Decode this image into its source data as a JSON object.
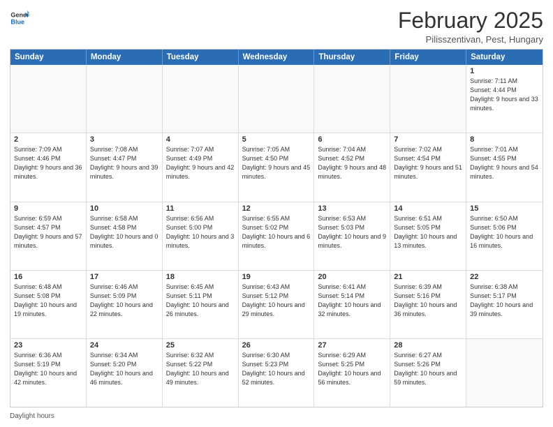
{
  "logo": {
    "general": "General",
    "blue": "Blue"
  },
  "title": "February 2025",
  "location": "Pilisszentivan, Pest, Hungary",
  "header_days": [
    "Sunday",
    "Monday",
    "Tuesday",
    "Wednesday",
    "Thursday",
    "Friday",
    "Saturday"
  ],
  "weeks": [
    [
      {
        "day": "",
        "info": ""
      },
      {
        "day": "",
        "info": ""
      },
      {
        "day": "",
        "info": ""
      },
      {
        "day": "",
        "info": ""
      },
      {
        "day": "",
        "info": ""
      },
      {
        "day": "",
        "info": ""
      },
      {
        "day": "1",
        "info": "Sunrise: 7:11 AM\nSunset: 4:44 PM\nDaylight: 9 hours and 33 minutes."
      }
    ],
    [
      {
        "day": "2",
        "info": "Sunrise: 7:09 AM\nSunset: 4:46 PM\nDaylight: 9 hours and 36 minutes."
      },
      {
        "day": "3",
        "info": "Sunrise: 7:08 AM\nSunset: 4:47 PM\nDaylight: 9 hours and 39 minutes."
      },
      {
        "day": "4",
        "info": "Sunrise: 7:07 AM\nSunset: 4:49 PM\nDaylight: 9 hours and 42 minutes."
      },
      {
        "day": "5",
        "info": "Sunrise: 7:05 AM\nSunset: 4:50 PM\nDaylight: 9 hours and 45 minutes."
      },
      {
        "day": "6",
        "info": "Sunrise: 7:04 AM\nSunset: 4:52 PM\nDaylight: 9 hours and 48 minutes."
      },
      {
        "day": "7",
        "info": "Sunrise: 7:02 AM\nSunset: 4:54 PM\nDaylight: 9 hours and 51 minutes."
      },
      {
        "day": "8",
        "info": "Sunrise: 7:01 AM\nSunset: 4:55 PM\nDaylight: 9 hours and 54 minutes."
      }
    ],
    [
      {
        "day": "9",
        "info": "Sunrise: 6:59 AM\nSunset: 4:57 PM\nDaylight: 9 hours and 57 minutes."
      },
      {
        "day": "10",
        "info": "Sunrise: 6:58 AM\nSunset: 4:58 PM\nDaylight: 10 hours and 0 minutes."
      },
      {
        "day": "11",
        "info": "Sunrise: 6:56 AM\nSunset: 5:00 PM\nDaylight: 10 hours and 3 minutes."
      },
      {
        "day": "12",
        "info": "Sunrise: 6:55 AM\nSunset: 5:02 PM\nDaylight: 10 hours and 6 minutes."
      },
      {
        "day": "13",
        "info": "Sunrise: 6:53 AM\nSunset: 5:03 PM\nDaylight: 10 hours and 9 minutes."
      },
      {
        "day": "14",
        "info": "Sunrise: 6:51 AM\nSunset: 5:05 PM\nDaylight: 10 hours and 13 minutes."
      },
      {
        "day": "15",
        "info": "Sunrise: 6:50 AM\nSunset: 5:06 PM\nDaylight: 10 hours and 16 minutes."
      }
    ],
    [
      {
        "day": "16",
        "info": "Sunrise: 6:48 AM\nSunset: 5:08 PM\nDaylight: 10 hours and 19 minutes."
      },
      {
        "day": "17",
        "info": "Sunrise: 6:46 AM\nSunset: 5:09 PM\nDaylight: 10 hours and 22 minutes."
      },
      {
        "day": "18",
        "info": "Sunrise: 6:45 AM\nSunset: 5:11 PM\nDaylight: 10 hours and 26 minutes."
      },
      {
        "day": "19",
        "info": "Sunrise: 6:43 AM\nSunset: 5:12 PM\nDaylight: 10 hours and 29 minutes."
      },
      {
        "day": "20",
        "info": "Sunrise: 6:41 AM\nSunset: 5:14 PM\nDaylight: 10 hours and 32 minutes."
      },
      {
        "day": "21",
        "info": "Sunrise: 6:39 AM\nSunset: 5:16 PM\nDaylight: 10 hours and 36 minutes."
      },
      {
        "day": "22",
        "info": "Sunrise: 6:38 AM\nSunset: 5:17 PM\nDaylight: 10 hours and 39 minutes."
      }
    ],
    [
      {
        "day": "23",
        "info": "Sunrise: 6:36 AM\nSunset: 5:19 PM\nDaylight: 10 hours and 42 minutes."
      },
      {
        "day": "24",
        "info": "Sunrise: 6:34 AM\nSunset: 5:20 PM\nDaylight: 10 hours and 46 minutes."
      },
      {
        "day": "25",
        "info": "Sunrise: 6:32 AM\nSunset: 5:22 PM\nDaylight: 10 hours and 49 minutes."
      },
      {
        "day": "26",
        "info": "Sunrise: 6:30 AM\nSunset: 5:23 PM\nDaylight: 10 hours and 52 minutes."
      },
      {
        "day": "27",
        "info": "Sunrise: 6:29 AM\nSunset: 5:25 PM\nDaylight: 10 hours and 56 minutes."
      },
      {
        "day": "28",
        "info": "Sunrise: 6:27 AM\nSunset: 5:26 PM\nDaylight: 10 hours and 59 minutes."
      },
      {
        "day": "",
        "info": ""
      }
    ]
  ],
  "legend": "Daylight hours"
}
